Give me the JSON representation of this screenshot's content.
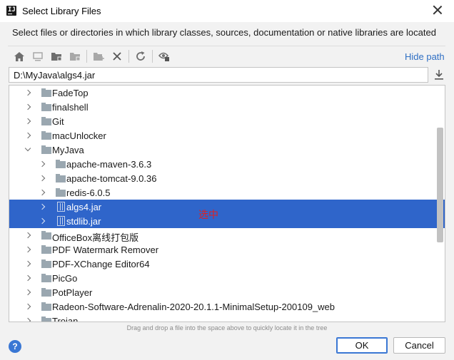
{
  "window": {
    "title": "Select Library Files",
    "description": "Select files or directories in which library classes, sources, documentation or native libraries are located"
  },
  "toolbar": {
    "icons": [
      "home-icon",
      "desktop-icon",
      "project-folder-icon",
      "module-folder-icon",
      "new-folder-icon",
      "delete-icon",
      "refresh-icon",
      "show-hidden-icon"
    ],
    "hide_path_label": "Hide path"
  },
  "path_field": {
    "value": "D:\\MyJava\\algs4.jar"
  },
  "tree": {
    "items": [
      {
        "label": "FadeTop",
        "type": "folder",
        "expanded": false,
        "depth": 0
      },
      {
        "label": "finalshell",
        "type": "folder",
        "expanded": false,
        "depth": 0
      },
      {
        "label": "Git",
        "type": "folder",
        "expanded": false,
        "depth": 0
      },
      {
        "label": "macUnlocker",
        "type": "folder",
        "expanded": false,
        "depth": 0
      },
      {
        "label": "MyJava",
        "type": "folder",
        "expanded": true,
        "depth": 0
      },
      {
        "label": "apache-maven-3.6.3",
        "type": "folder",
        "expanded": false,
        "depth": 1
      },
      {
        "label": "apache-tomcat-9.0.36",
        "type": "folder",
        "expanded": false,
        "depth": 1
      },
      {
        "label": "redis-6.0.5",
        "type": "folder",
        "expanded": false,
        "depth": 1
      },
      {
        "label": "algs4.jar",
        "type": "jar",
        "expanded": false,
        "depth": 1,
        "selected": true
      },
      {
        "label": "stdlib.jar",
        "type": "jar",
        "expanded": false,
        "depth": 1,
        "selected": true
      },
      {
        "label": "OfficeBox离线打包版",
        "type": "folder",
        "expanded": false,
        "depth": 0
      },
      {
        "label": "PDF Watermark Remover",
        "type": "folder",
        "expanded": false,
        "depth": 0
      },
      {
        "label": "PDF-XChange Editor64",
        "type": "folder",
        "expanded": false,
        "depth": 0
      },
      {
        "label": "PicGo",
        "type": "folder",
        "expanded": false,
        "depth": 0
      },
      {
        "label": "PotPlayer",
        "type": "folder",
        "expanded": false,
        "depth": 0
      },
      {
        "label": "Radeon-Software-Adrenalin-2020-20.1.1-MinimalSetup-200109_web",
        "type": "folder",
        "expanded": false,
        "depth": 0
      },
      {
        "label": "Trojan",
        "type": "folder",
        "expanded": false,
        "depth": 0
      }
    ],
    "annotation": "选中"
  },
  "footer": {
    "hint": "Drag and drop a file into the space above to quickly locate it in the tree",
    "help_label": "?",
    "ok_label": "OK",
    "cancel_label": "Cancel"
  },
  "colors": {
    "selection": "#2f65ca",
    "link": "#2f6fc4",
    "annotation": "#e02020",
    "folder": "#9aa7b0"
  }
}
